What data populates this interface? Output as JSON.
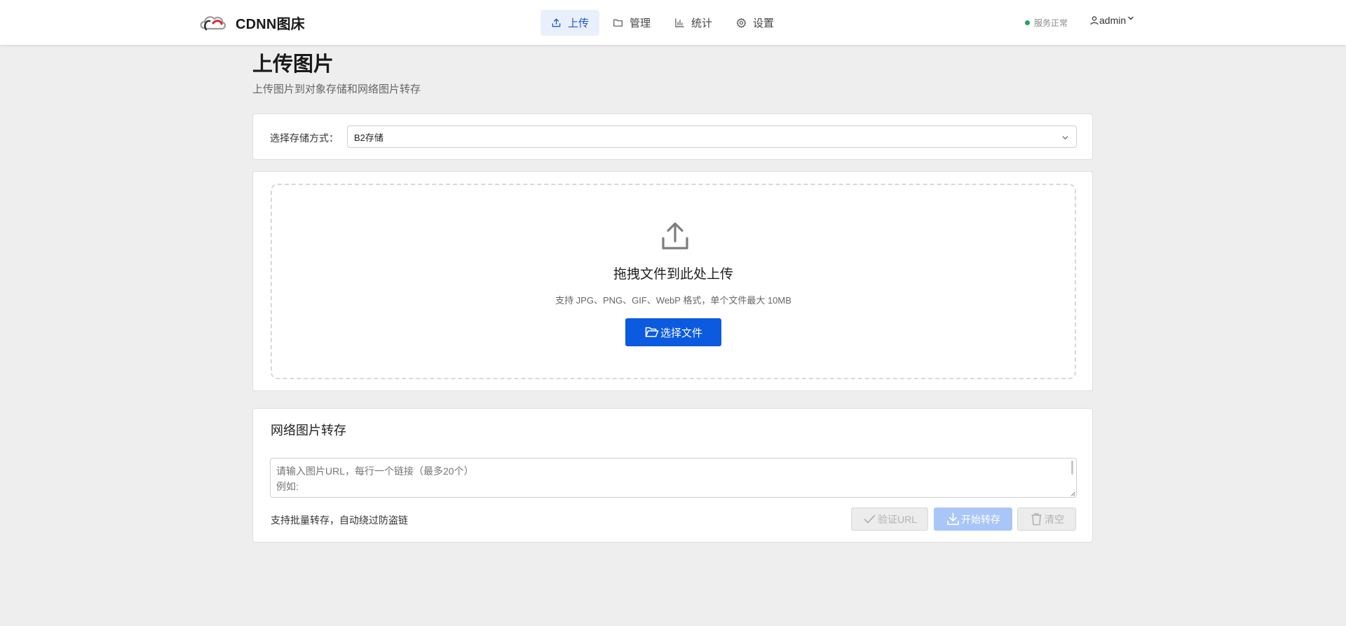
{
  "header": {
    "brand_name": "CDNN图床",
    "nav": [
      {
        "label": "上传",
        "icon": "upload-icon",
        "active": true
      },
      {
        "label": "管理",
        "icon": "folder-icon",
        "active": false
      },
      {
        "label": "统计",
        "icon": "bar-chart-icon",
        "active": false
      },
      {
        "label": "设置",
        "icon": "gear-icon",
        "active": false
      }
    ],
    "status_text": "服务正常",
    "username": "admin"
  },
  "page": {
    "title": "上传图片",
    "subtitle": "上传图片到对象存储和网络图片转存"
  },
  "storage": {
    "label": "选择存储方式：",
    "selected": "B2存储"
  },
  "upload": {
    "drop_title": "拖拽文件到此处上传",
    "drop_hint": "支持 JPG、PNG、GIF、WebP 格式，单个文件最大 10MB",
    "choose_button": "选择文件"
  },
  "transfer": {
    "title": "网络图片转存",
    "placeholder": "请输入图片URL，每行一个链接（最多20个）\n例如:",
    "hint": "支持批量转存，自动绕过防盗链",
    "verify_button": "验证URL",
    "start_button": "开始转存",
    "clear_button": "清空"
  },
  "colors": {
    "primary": "#0b5ae0",
    "primary_disabled": "#a9c6f8",
    "status_ok": "#1fa463",
    "nav_active_bg": "#eaf0fb",
    "background": "#eeeeee"
  }
}
